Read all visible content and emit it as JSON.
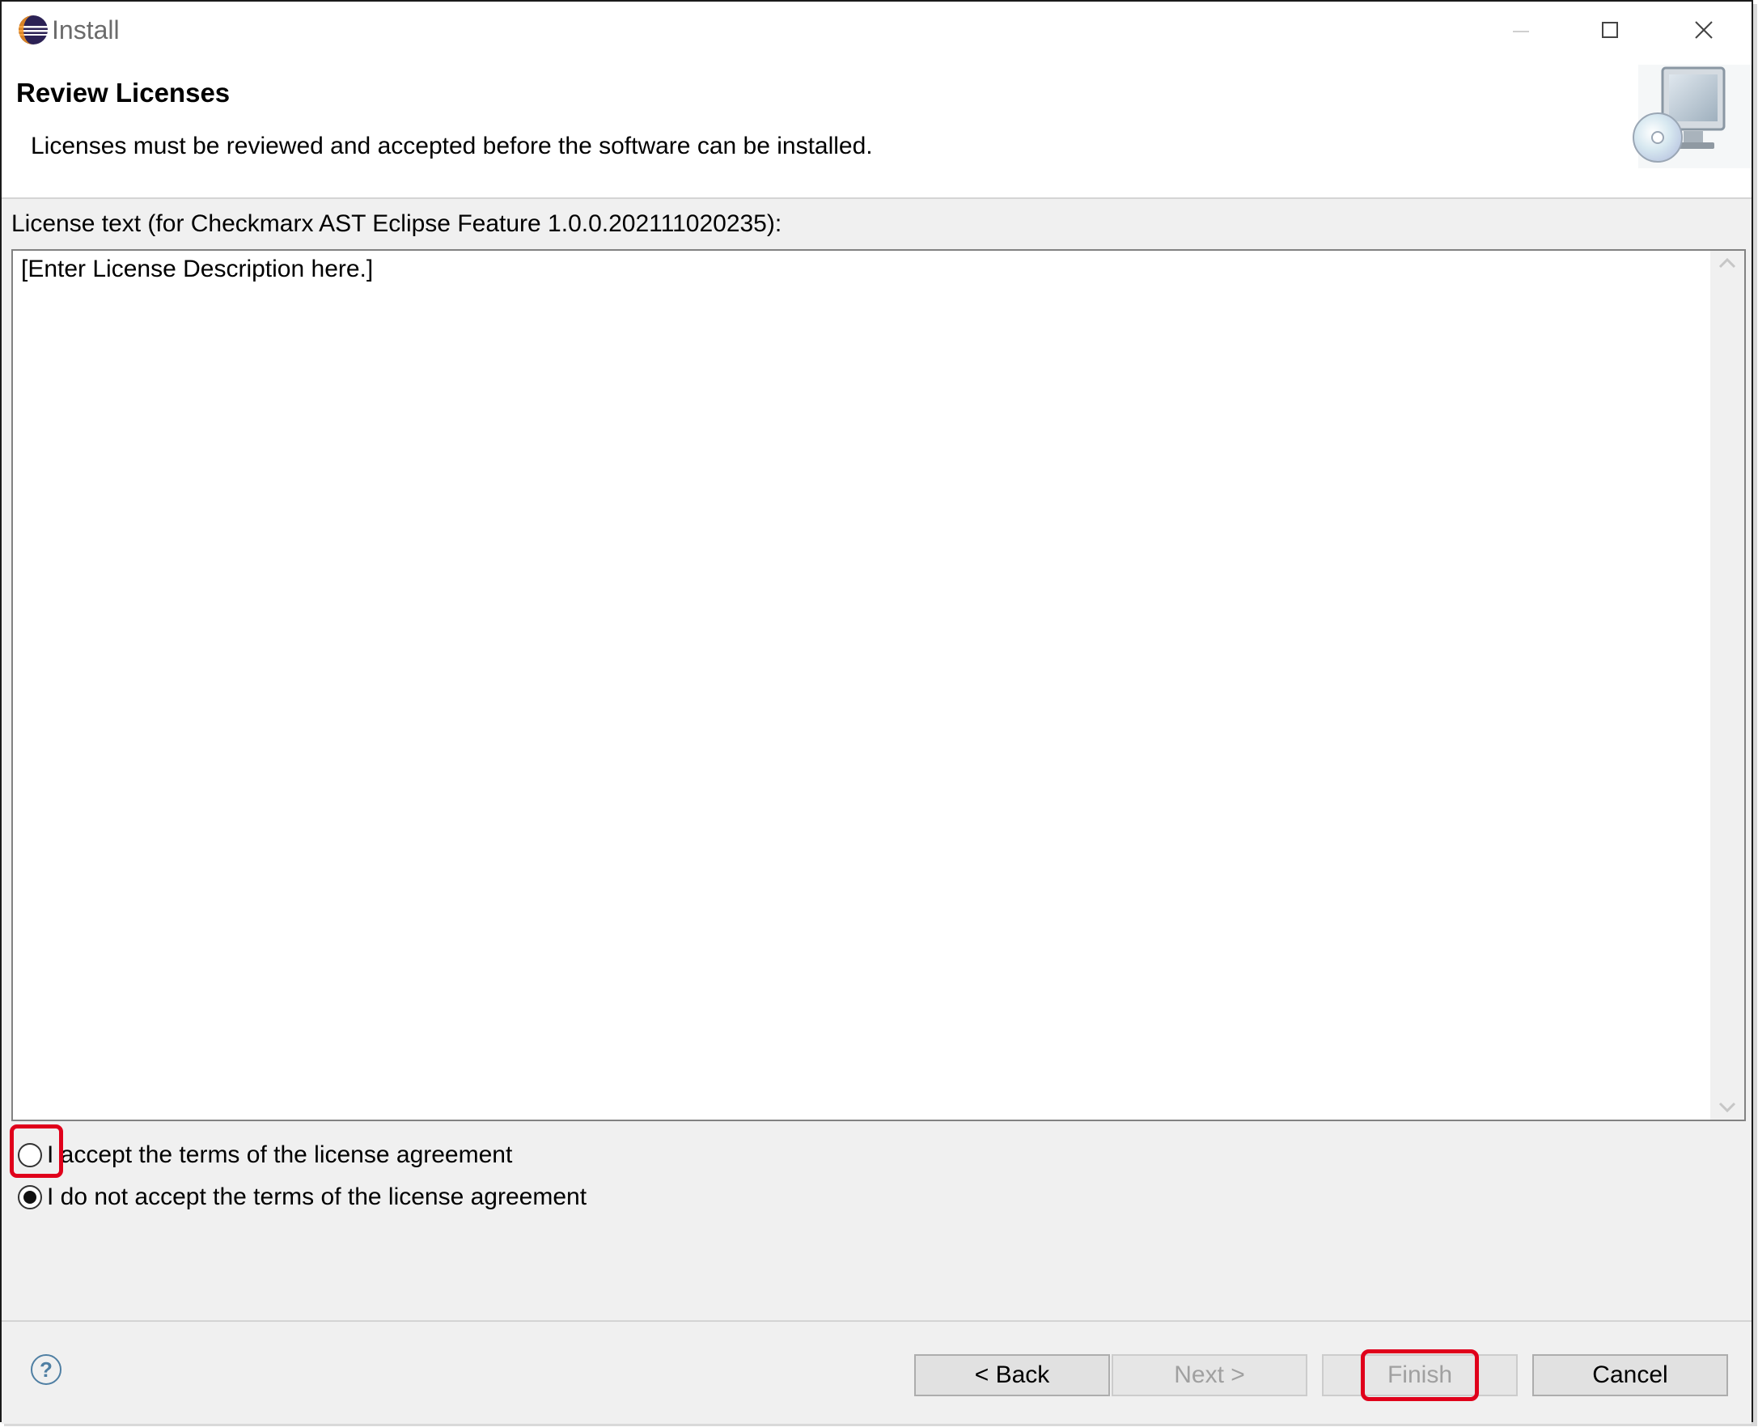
{
  "window": {
    "title": "Install"
  },
  "header": {
    "title": "Review Licenses",
    "description": "Licenses must be reviewed and accepted before the software can be installed.",
    "graphic_icon": "install-wizard-graphic-icon"
  },
  "license": {
    "label": "License text (for Checkmarx AST Eclipse Feature 1.0.0.202111020235):",
    "text": "[Enter License Description here.]"
  },
  "options": {
    "accept_label": "I accept the terms of the license agreement",
    "accept_checked": false,
    "decline_label": "I do not accept the terms of the license agreement",
    "decline_checked": true
  },
  "footer": {
    "help_glyph": "?",
    "back_label": "< Back",
    "next_label": "Next >",
    "finish_label": "Finish",
    "cancel_label": "Cancel",
    "next_enabled": false,
    "finish_enabled": false
  },
  "colors": {
    "highlight": "#e0001b",
    "dialog_bg": "#f0f0f0",
    "help_icon": "#4f7fa3"
  }
}
